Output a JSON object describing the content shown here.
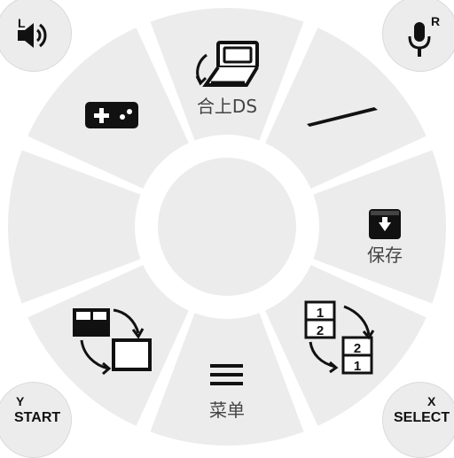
{
  "wheel": {
    "close_ds_label": "合上DS",
    "save_label": "保存",
    "menu_label": "菜单"
  },
  "corners": {
    "l_label": "L",
    "r_label": "R",
    "y_label": "Y",
    "start_label": "START",
    "x_label": "X",
    "select_label": "SELECT"
  },
  "icons": {
    "top": "close-ds-icon",
    "top_right": "stylus-icon",
    "right": "save-icon",
    "bottom_right": "swap-screens-icon",
    "bottom": "menu-icon",
    "bottom_left": "screen-layout-icon",
    "top_left": "gamepad-icon",
    "l": "speaker-icon",
    "r": "microphone-icon"
  },
  "colors": {
    "segment": "#ececec",
    "gap": "#ffffff",
    "icon": "#111111",
    "label": "#444444"
  }
}
